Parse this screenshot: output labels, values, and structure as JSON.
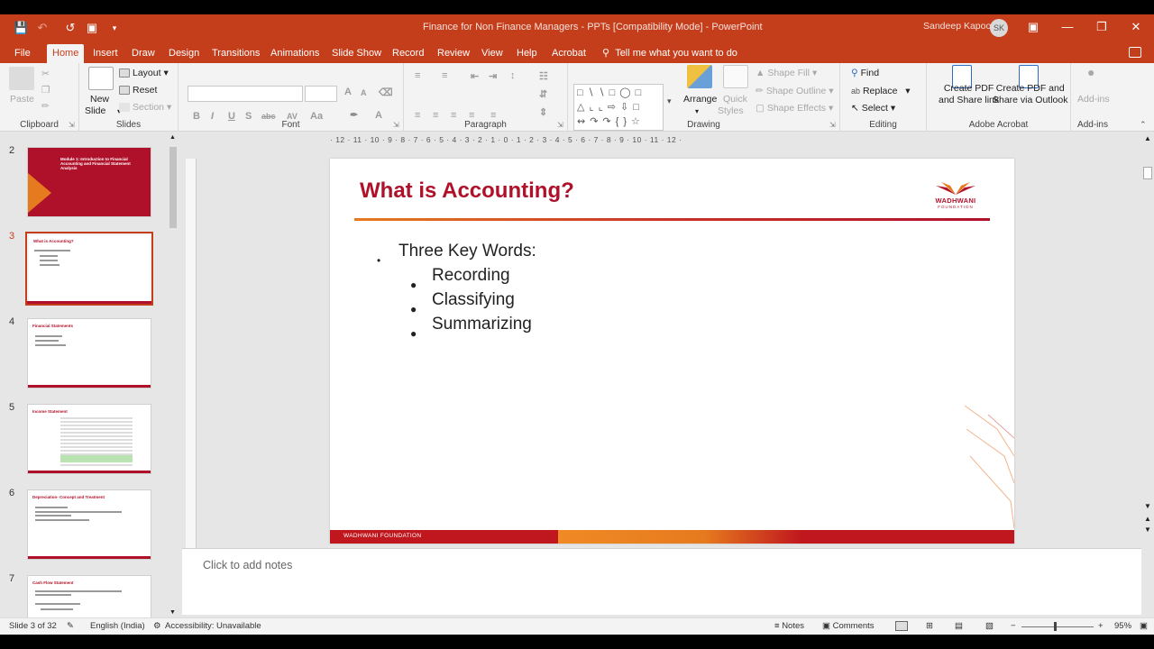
{
  "window": {
    "title": "Finance for Non Finance Managers - PPTs [Compatibility Mode]  -  PowerPoint",
    "user_name": "Sandeep Kapoor",
    "user_initials": "SK"
  },
  "tabs": [
    "File",
    "Home",
    "Insert",
    "Draw",
    "Design",
    "Transitions",
    "Animations",
    "Slide Show",
    "Record",
    "Review",
    "View",
    "Help",
    "Acrobat"
  ],
  "active_tab": "Home",
  "tell_me": "Tell me what you want to do",
  "ribbon": {
    "clipboard": {
      "paste": "Paste",
      "label": "Clipboard"
    },
    "slides": {
      "new_slide_1": "New",
      "new_slide_2": "Slide",
      "layout": "Layout",
      "reset": "Reset",
      "section": "Section",
      "label": "Slides"
    },
    "font": {
      "label": "Font"
    },
    "paragraph": {
      "label": "Paragraph"
    },
    "drawing": {
      "arrange": "Arrange",
      "quick_styles_1": "Quick",
      "quick_styles_2": "Styles",
      "shape_fill": "Shape Fill",
      "shape_outline": "Shape Outline",
      "shape_effects": "Shape Effects",
      "label": "Drawing"
    },
    "editing": {
      "find": "Find",
      "replace": "Replace",
      "select": "Select",
      "label": "Editing"
    },
    "acrobat": {
      "create_pdf_link_1": "Create PDF",
      "create_pdf_link_2": "and Share link",
      "create_pdf_outlook_1": "Create PDF and",
      "create_pdf_outlook_2": "Share via Outlook",
      "label": "Adobe Acrobat"
    },
    "addins": {
      "addins": "Add-ins",
      "label": "Add-ins"
    }
  },
  "ruler": {
    "ticks": "· 12 · 11 · 10 · 9 · 8 · 7 · 6 · 5 · 4 · 3 · 2 · 1 · 0 · 1 · 2 · 3 · 4 · 5 · 6 · 7 · 8 · 9 · 10 · 11 · 12 ·"
  },
  "thumbnails": [
    {
      "num": "2",
      "title": "Module 1:\nIntroduction to Financial Accounting and Financial Statement Analysis"
    },
    {
      "num": "3",
      "title": "What is Accounting?"
    },
    {
      "num": "4",
      "title": "Financial Statements"
    },
    {
      "num": "5",
      "title": "Income Statement"
    },
    {
      "num": "6",
      "title": "Depreciation- Concept and Treatment"
    },
    {
      "num": "7",
      "title": "Cash Flow Statement"
    }
  ],
  "slide": {
    "title": "What is Accounting?",
    "logo_name": "WADHWANI",
    "logo_sub": "FOUNDATION",
    "bullet_main": "Three Key Words:",
    "sub_bullets": [
      "Recording",
      "Classifying",
      "Summarizing"
    ],
    "footer": "WADHWANI FOUNDATION"
  },
  "notes_placeholder": "Click to add notes",
  "status": {
    "slide_info": "Slide 3 of 32",
    "language": "English (India)",
    "accessibility": "Accessibility: Unavailable",
    "notes": "Notes",
    "comments": "Comments",
    "zoom": "95%"
  },
  "colors": {
    "accent": "#c43e1c",
    "slide_red": "#b0112a",
    "slide_orange": "#e67a1e"
  }
}
